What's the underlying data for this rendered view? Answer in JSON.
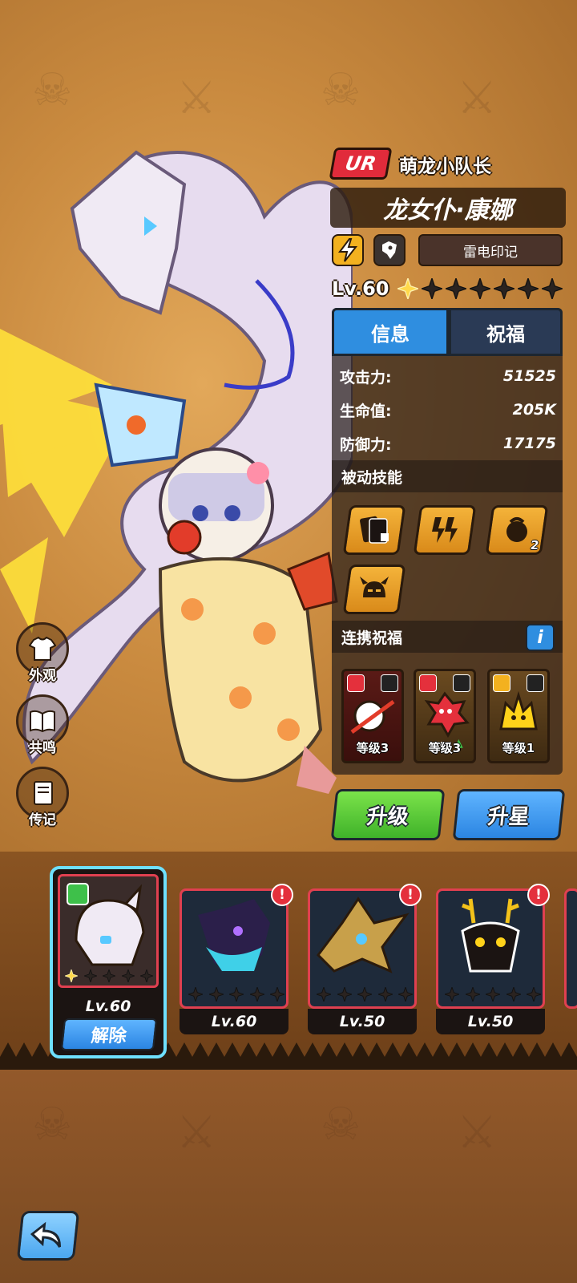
{
  "hero": {
    "rarity": "UR",
    "subtitle": "萌龙小队长",
    "name": "龙女仆·康娜",
    "mark": "雷电印记",
    "level": "Lv.60",
    "stars_filled": 1,
    "stars_total": 7
  },
  "tabs": {
    "info": "信息",
    "blessing": "祝福"
  },
  "stats": [
    {
      "label": "攻击力:",
      "value": "51525"
    },
    {
      "label": "生命值:",
      "value": "205K"
    },
    {
      "label": "防御力:",
      "value": "17175"
    }
  ],
  "sections": {
    "passive": "被动技能",
    "linked": "连携祝福",
    "info_icon": "i"
  },
  "skills": [
    {
      "icon": "cards-icon",
      "count": ""
    },
    {
      "icon": "lightning-claw-icon",
      "count": ""
    },
    {
      "icon": "fire-orb-icon",
      "count": "2"
    },
    {
      "icon": "horned-helmet-icon",
      "count": ""
    }
  ],
  "blessings": [
    {
      "icon": "meat-skewer-icon",
      "level": "等级3",
      "tag": ""
    },
    {
      "icon": "red-beast-icon",
      "level": "等级3",
      "tag": "ELE"
    },
    {
      "icon": "thunder-chick-icon",
      "level": "等级1",
      "tag": ""
    }
  ],
  "side_buttons": {
    "outfit": "外观",
    "resonance": "共鸣",
    "biography": "传记"
  },
  "actions": {
    "upgrade": "升级",
    "star_up": "升星"
  },
  "pets": {
    "selected": {
      "level": "Lv.60",
      "unequip": "解除"
    },
    "list": [
      {
        "level": "Lv.60",
        "icon": "shadow-dragon-icon"
      },
      {
        "level": "Lv.50",
        "icon": "golden-bird-icon"
      },
      {
        "level": "Lv.50",
        "icon": "antler-beast-icon"
      }
    ],
    "alert": "!"
  },
  "colors": {
    "rarity_red": "#e12b3b",
    "tab_blue": "#2f8ee0",
    "upgrade_green": "#3fb22a",
    "star_blue": "#2b85e2",
    "selected_outline": "#6ee0ff"
  }
}
